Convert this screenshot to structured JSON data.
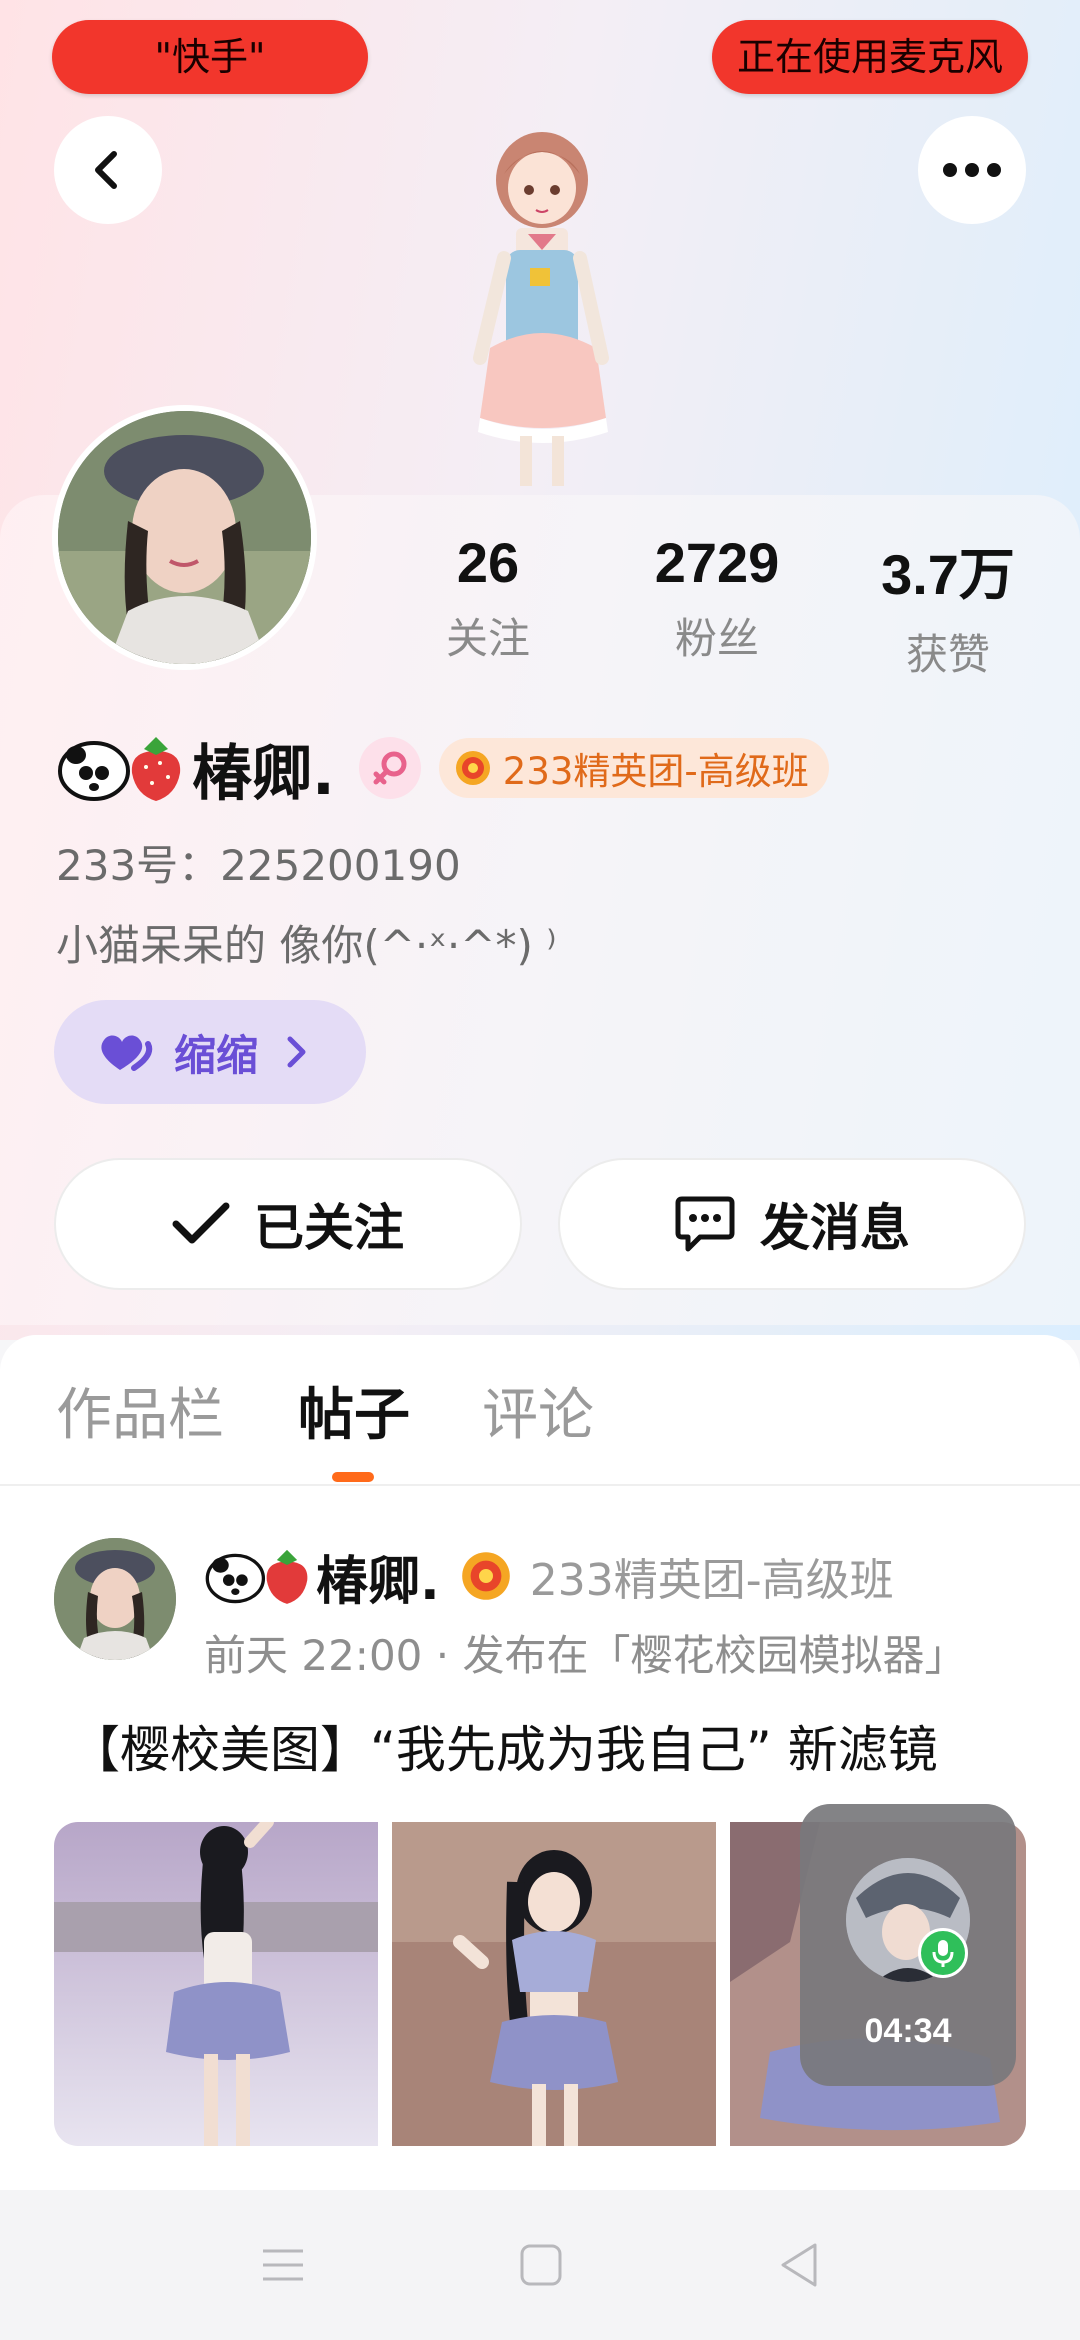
{
  "top_pills": {
    "app_name": "\"快手\"",
    "mic_status": "正在使用麦克风"
  },
  "profile": {
    "stats": [
      {
        "value": "26",
        "label": "关注"
      },
      {
        "value": "2729",
        "label": "粉丝"
      },
      {
        "value": "3.7万",
        "label": "获赞"
      }
    ],
    "nickname": "椿卿.",
    "group_badge": "233精英团-高级班",
    "uid": "233号：225200190",
    "bio": "小猫呆呆的  像你(^·ˣ·^*) ⁾",
    "family_tag": "缩缩",
    "follow_label": "已关注",
    "message_label": "发消息"
  },
  "tabs": [
    {
      "label": "作品栏"
    },
    {
      "label": "帖子"
    },
    {
      "label": "评论"
    }
  ],
  "post": {
    "nickname": "椿卿.",
    "group": "233精英团-高级班",
    "meta": "前天 22:00 · 发布在「樱花校园模拟器」",
    "title": "【樱校美图】“我先成为我自己” 新滤镜"
  },
  "call": {
    "duration": "04:34"
  },
  "colors": {
    "accent_orange": "#ff6a1a",
    "pill_red": "#f2362c",
    "family_purple": "#6a4fd6",
    "badge_orange": "#e06a1a",
    "mic_green": "#2fbf5a"
  }
}
